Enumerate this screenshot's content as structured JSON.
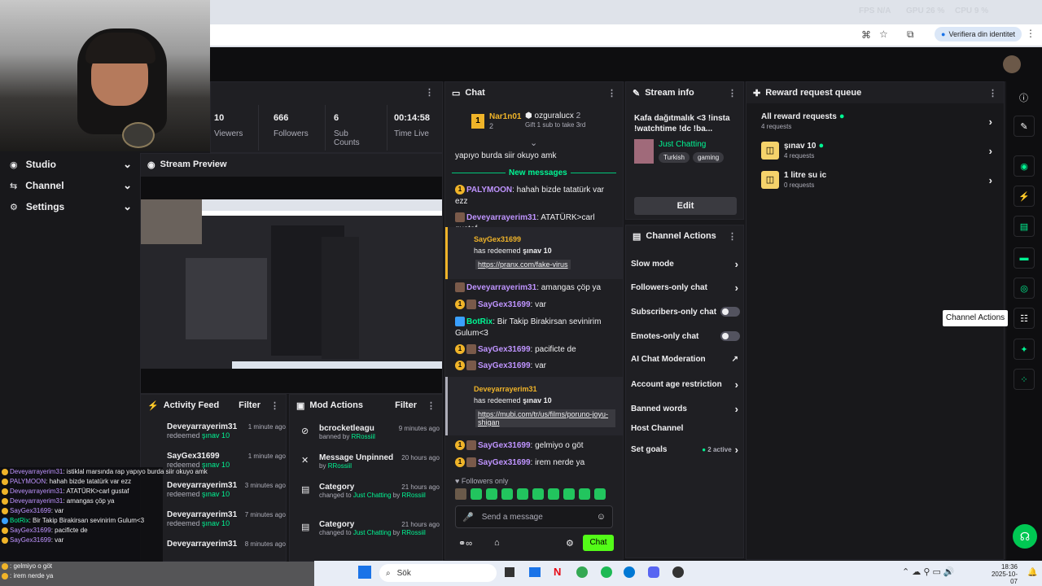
{
  "browser": {
    "perf": [
      "FPS N/A",
      "GPU 26 %",
      "CPU 9 %"
    ],
    "verify_label": "Verifiera din identitet"
  },
  "sidebar": {
    "items": [
      {
        "label": "Studio"
      },
      {
        "label": "Channel"
      },
      {
        "label": "Settings"
      }
    ]
  },
  "stats": [
    {
      "value": "10",
      "label": "Viewers"
    },
    {
      "value": "666",
      "label": "Followers"
    },
    {
      "value": "6",
      "label": "Sub Counts"
    },
    {
      "value": "00:14:58",
      "label": "Time Live"
    }
  ],
  "stream_preview": {
    "title": "Stream Preview"
  },
  "activity": {
    "title": "Activity Feed",
    "filter": "Filter",
    "items": [
      {
        "user": "Deveyarrayerim31",
        "action": "redeemed",
        "reward": "şınav 10",
        "time": "1 minute ago"
      },
      {
        "user": "SayGex31699",
        "action": "redeemed",
        "reward": "şınav 10",
        "time": "1 minute ago"
      },
      {
        "user": "Deveyarrayerim31",
        "action": "redeemed",
        "reward": "şınav 10",
        "time": "3 minutes ago"
      },
      {
        "user": "Deveyarrayerim31",
        "action": "redeemed",
        "reward": "şınav 10",
        "time": "7 minutes ago"
      },
      {
        "user": "Deveyarrayerim31",
        "action": "redeemed",
        "reward": "",
        "time": "8 minutes ago"
      }
    ]
  },
  "mod": {
    "title": "Mod Actions",
    "filter": "Filter",
    "items": [
      {
        "title": "bcrocketleagu",
        "sub": "banned by",
        "by": "RRossiil",
        "time": "9 minutes ago"
      },
      {
        "title": "Message Unpinned",
        "sub": "by",
        "by": "RRossiil",
        "time": "20 hours ago"
      },
      {
        "title": "Category",
        "sub": "changed to",
        "cat": "Just Chatting",
        "by": "RRossiil",
        "time": "21 hours ago"
      },
      {
        "title": "Category",
        "sub": "changed to",
        "cat": "Just Chatting",
        "by": "RRossiil",
        "time": "21 hours ago"
      }
    ]
  },
  "chat": {
    "title": "Chat",
    "leader": {
      "rank": "1",
      "name": "Nar1n01",
      "count": "2"
    },
    "gifter": {
      "name": "ozguralucx",
      "count": "2",
      "note": "Gift 1 sub to take 3rd"
    },
    "prev": "yapıyo burda siir okuyo amk",
    "new_label": "New messages",
    "messages": [
      {
        "user": "PALYMOON",
        "text": ": hahah bizde tatatürk var ezz"
      },
      {
        "user": "Deveyarrayerim31",
        "text": ": ATATÜRK>carl gustaf"
      },
      {
        "user": "Deveyarrayerim31",
        "text": ": amangas çöp ya"
      },
      {
        "user": "SayGex31699",
        "text": ": var"
      },
      {
        "user": "BotRix",
        "text": ": Bir Takip Birakirsan sevinirim Gulum<3"
      },
      {
        "user": "SayGex31699",
        "text": ": pacificte de"
      },
      {
        "user": "SayGex31699",
        "text": ": var"
      },
      {
        "user": "SayGex31699",
        "text": ": gelmiyo o göt"
      },
      {
        "user": "SayGex31699",
        "text": ": irem nerde ya"
      }
    ],
    "redeem1": {
      "user": "SayGex31699",
      "line": "has redeemed",
      "reward": "şınav 10",
      "link": "https://pranx.com/fake-virus"
    },
    "redeem2": {
      "user": "Deveyarrayerim31",
      "line": "has redeemed",
      "reward": "şınav 10",
      "link": "https://mubi.com/tr/us/films/poruno-joyu-shigan"
    },
    "followers_only": "Followers only",
    "placeholder": "Send a message",
    "send": "Chat"
  },
  "stream_info": {
    "title": "Stream info",
    "stream_title": "Kafa dağıtmalık <3 !insta !watchtime !dc !ba...",
    "category": "Just Chatting",
    "tags": [
      "Turkish",
      "gaming"
    ],
    "edit": "Edit"
  },
  "channel_actions": {
    "title": "Channel Actions",
    "items": [
      {
        "label": "Slow mode",
        "type": "chev"
      },
      {
        "label": "Followers-only chat",
        "type": "chev"
      },
      {
        "label": "Subscribers-only chat",
        "type": "toggle"
      },
      {
        "label": "Emotes-only chat",
        "type": "toggle"
      },
      {
        "label": "AI Chat Moderation",
        "type": "ext"
      },
      {
        "label": "Account age restriction",
        "type": "chev"
      },
      {
        "label": "Banned words",
        "type": "chev"
      },
      {
        "label": "Host Channel",
        "type": "none"
      },
      {
        "label": "Set goals",
        "type": "chev",
        "extra": "2 active"
      }
    ]
  },
  "rewards": {
    "title": "Reward request queue",
    "all": {
      "label": "All reward requests",
      "count": "4 requests"
    },
    "items": [
      {
        "label": "şınav 10",
        "count": "4 requests"
      },
      {
        "label": "1 litre su ic",
        "count": "0 requests"
      }
    ]
  },
  "tooltip": "Channel Actions",
  "overlay": [
    {
      "user": "Deveyarrayerim31",
      "text": ": istiklal marsında rap yapıyo burda siir okuyo amk"
    },
    {
      "user": "PALYMOON",
      "text": ": hahah bizde tatatürk var ezz"
    },
    {
      "user": "Deveyarrayerim31",
      "text": ": ATATÜRK>carl gustaf"
    },
    {
      "user": "Deveyarrayerim31",
      "text": ": amangas çöp ya"
    },
    {
      "user": "SayGex31699",
      "text": ": var"
    },
    {
      "user": "BotRix",
      "text": ": Bir Takip Birakirsan sevinirim Gulum<3"
    },
    {
      "user": "SayGex31699",
      "text": ": pacificte de"
    },
    {
      "user": "SayGex31699",
      "text": ": var"
    },
    {
      "user": "",
      "text": ": gelmiyo o göt"
    },
    {
      "user": "",
      "text": ": irem nerde ya"
    }
  ],
  "taskbar": {
    "search": "Sök",
    "time": "18:36",
    "date": "2025-10-07"
  }
}
